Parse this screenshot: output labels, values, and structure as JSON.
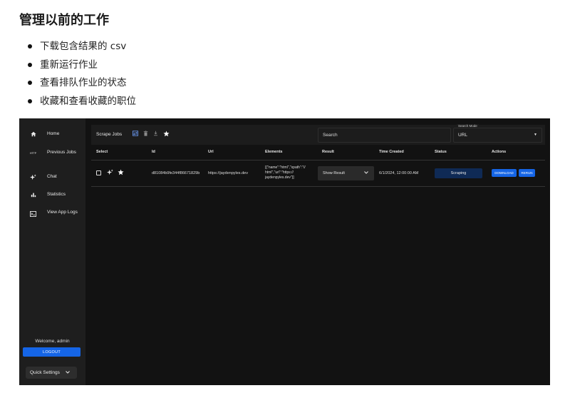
{
  "doc": {
    "title": "管理以前的工作",
    "bullets": [
      "下载包含结果的 csv",
      "重新运行作业",
      "查看排队作业的状态",
      "收藏和查看收藏的职位"
    ]
  },
  "app": {
    "sidebar": {
      "items": [
        {
          "label": "Home",
          "icon": "home-icon"
        },
        {
          "label": "Previous Jobs",
          "icon": "http-icon"
        },
        {
          "label": "Chat",
          "icon": "sparkle-icon"
        },
        {
          "label": "Statistics",
          "icon": "bar-chart-icon"
        },
        {
          "label": "View App Logs",
          "icon": "terminal-icon"
        }
      ],
      "welcome": "Welcome, admin",
      "logout": "LOGOUT",
      "quick_settings": "Quick Settings"
    },
    "toolbar": {
      "title": "Scrape Jobs",
      "search_placeholder": "Search",
      "search_mode_label": "Search Mode",
      "search_mode_value": "URL"
    },
    "table": {
      "headers": {
        "select": "Select",
        "id": "Id",
        "url": "Url",
        "elements": "Elements",
        "result": "Result",
        "time_created": "Time Created",
        "status": "Status",
        "actions": "Actions"
      },
      "row": {
        "id": "d81084b9fe344f86671829b",
        "url": "https://jaydenpyles.dev",
        "elements": "[{\"name\":\"html\",\"xpath\":\"//html\",\"url\":\"https://jaydenpyles.dev\"}]",
        "elements_lines": [
          "[{\"name\":\"html\",\"xpath\":\"//",
          "html\",\"url\":\"https://",
          "jaydenpyles.dev\"}]"
        ],
        "result": "Show Result",
        "time_created": "6/1/2024, 12:00:00 AM",
        "status": "Scraping",
        "download": "DOWNLOAD",
        "rerun": "RERUN"
      }
    },
    "colors": {
      "accent": "#1565e6",
      "background": "#121212",
      "sidebar": "#1e1e1e",
      "status_badge": "#0f2a55"
    }
  }
}
